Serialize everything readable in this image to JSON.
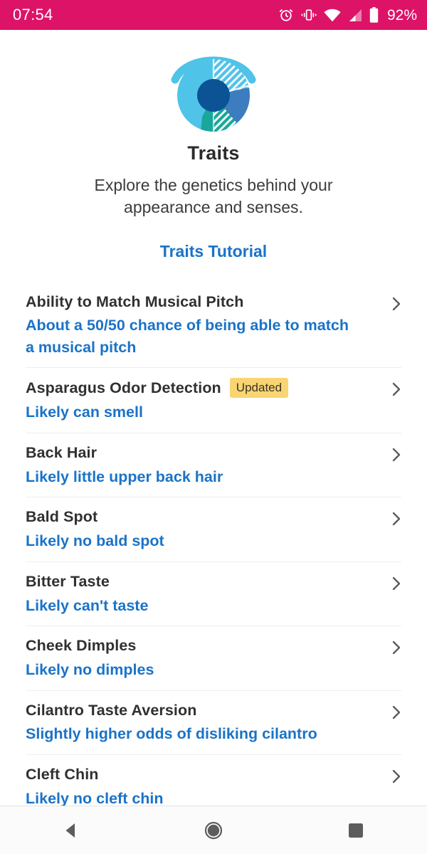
{
  "status_bar": {
    "time": "07:54",
    "battery_percent": "92%",
    "icons": [
      "alarm-clock-icon",
      "vibrate-icon",
      "wifi-icon",
      "cell-signal-icon",
      "battery-icon"
    ],
    "background_color": "#DD1367"
  },
  "hero": {
    "logo_icon": "traits-eye-logo",
    "title": "Traits",
    "description": "Explore the genetics behind your appearance and senses.",
    "tutorial_link": "Traits Tutorial",
    "link_color": "#1a73c8"
  },
  "traits": [
    {
      "name": "Ability to Match Musical Pitch",
      "description": "About a 50/50 chance of being able to match a musical pitch",
      "badge": ""
    },
    {
      "name": "Asparagus Odor Detection",
      "description": "Likely can smell",
      "badge": "Updated"
    },
    {
      "name": "Back Hair",
      "description": "Likely little upper back hair",
      "badge": ""
    },
    {
      "name": "Bald Spot",
      "description": "Likely no bald spot",
      "badge": ""
    },
    {
      "name": "Bitter Taste",
      "description": "Likely can't taste",
      "badge": ""
    },
    {
      "name": "Cheek Dimples",
      "description": "Likely no dimples",
      "badge": ""
    },
    {
      "name": "Cilantro Taste Aversion",
      "description": "Slightly higher odds of disliking cilantro",
      "badge": ""
    },
    {
      "name": "Cleft Chin",
      "description": "Likely no cleft chin",
      "badge": ""
    }
  ],
  "nav_bar": {
    "back": "back-button",
    "home": "home-button",
    "recents": "recents-button"
  },
  "colors": {
    "accent_blue": "#1a73c8",
    "badge_yellow": "#F8D572",
    "logo_light_blue": "#4FC3E8",
    "logo_mid_blue": "#3E7CC0",
    "logo_teal": "#17A89B",
    "logo_navy": "#0B5394"
  }
}
